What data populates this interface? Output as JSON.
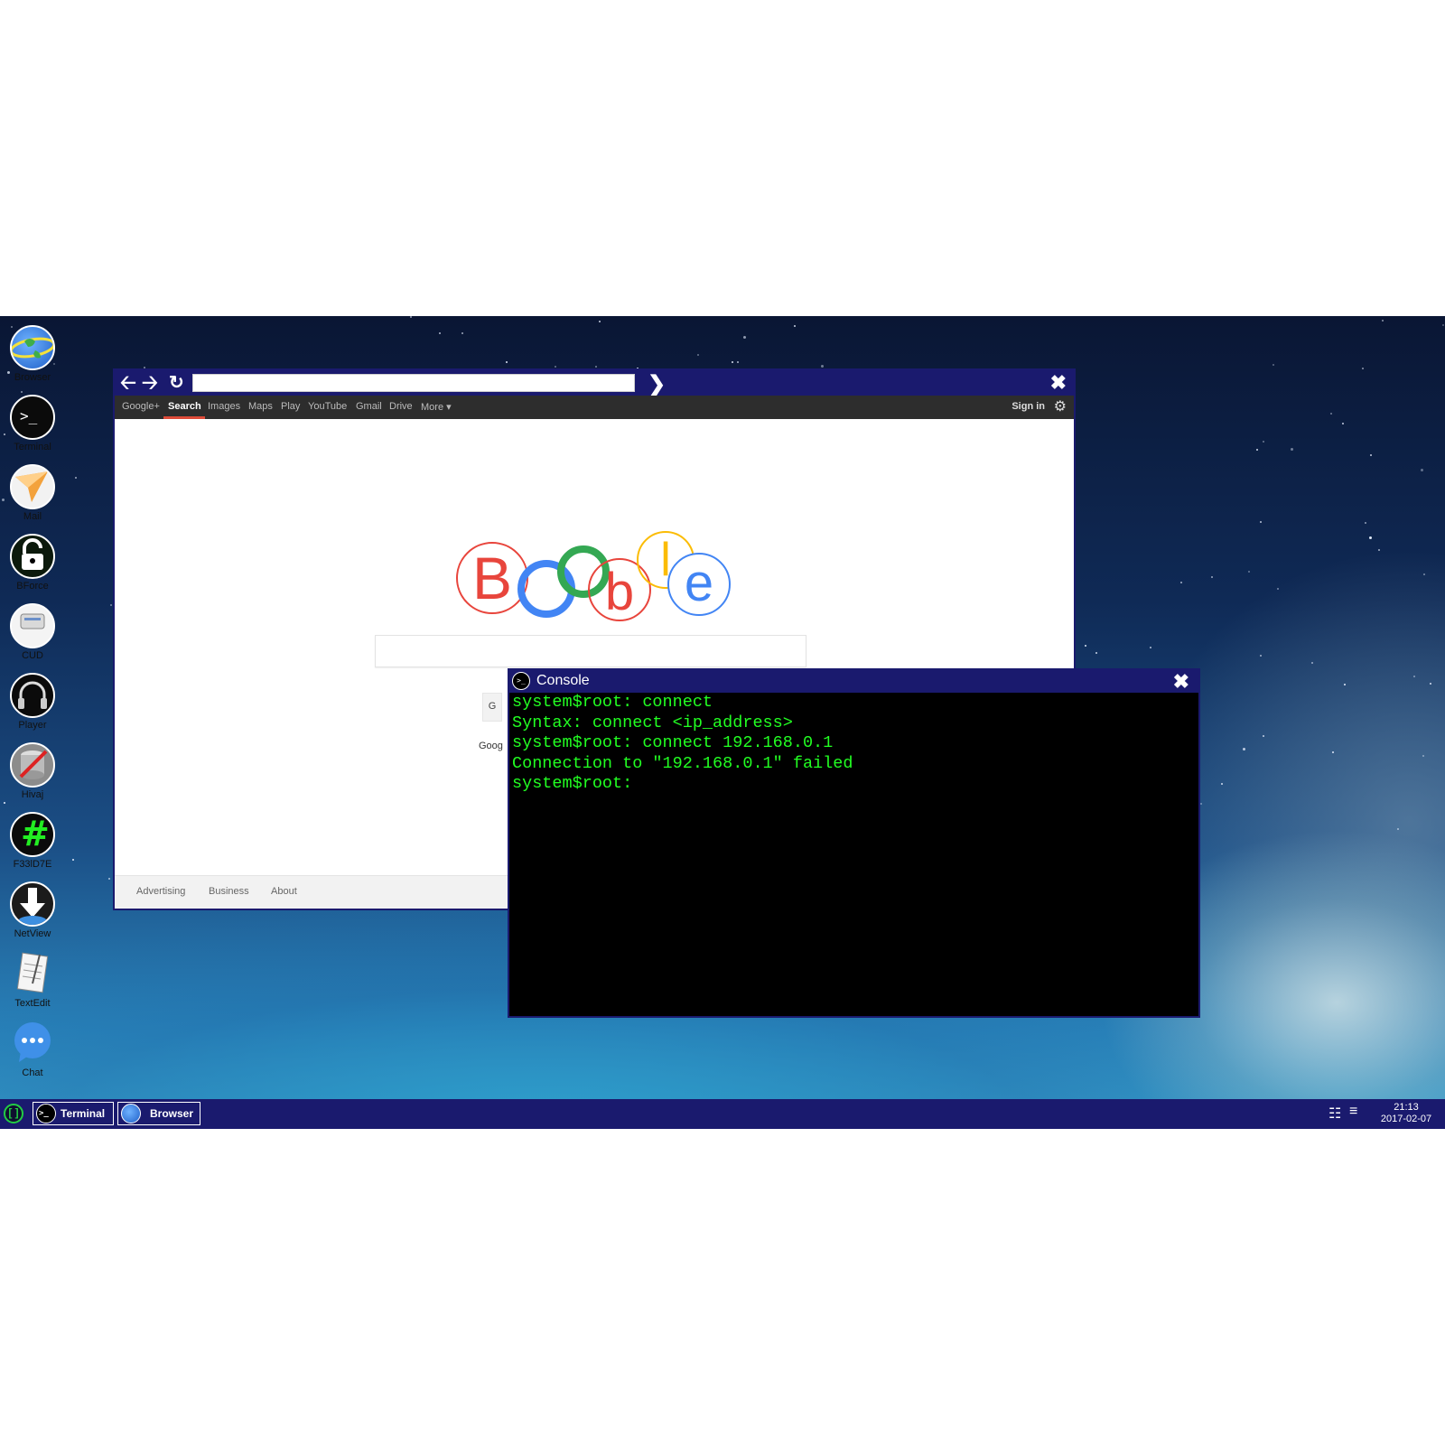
{
  "desktop_icons": [
    {
      "label": "Browser",
      "icon": "globe-icon"
    },
    {
      "label": "Terminal",
      "icon": "terminal-icon"
    },
    {
      "label": "Mail",
      "icon": "paper-plane-icon"
    },
    {
      "label": "BForce",
      "icon": "padlock-icon"
    },
    {
      "label": "CUD",
      "icon": "disk-drive-icon"
    },
    {
      "label": "Player",
      "icon": "headphones-icon"
    },
    {
      "label": "Hivaj",
      "icon": "database-syringe-icon"
    },
    {
      "label": "F33lD7E",
      "icon": "hash-icon"
    },
    {
      "label": "NetView",
      "icon": "download-arrow-icon"
    },
    {
      "label": "TextEdit",
      "icon": "notepad-icon"
    },
    {
      "label": "Chat",
      "icon": "chat-bubble-icon"
    }
  ],
  "browser": {
    "url": "",
    "gbar": {
      "items": [
        "Google+",
        "Search",
        "Images",
        "Maps",
        "Play",
        "YouTube",
        "Gmail",
        "Drive",
        "More ▾"
      ],
      "active": "Search",
      "sign_in": "Sign in"
    },
    "logo_letters": [
      "B",
      "o",
      "o",
      "b",
      "l",
      "e"
    ],
    "logo_colors": [
      "#e8453c",
      "#4285f4",
      "#34a853",
      "#e8453c",
      "#fbbc05",
      "#4285f4"
    ],
    "search_value": "",
    "partial_button_text": "G",
    "partial_text": "Goog",
    "footer": [
      "Advertising",
      "Business",
      "About"
    ]
  },
  "console": {
    "title": "Console",
    "lines": [
      "system$root: connect",
      "Syntax: connect <ip_address>",
      "system$root: connect 192.168.0.1",
      "Connection to \"192.168.0.1\" failed",
      "system$root:"
    ]
  },
  "taskbar": {
    "buttons": [
      {
        "label": "Terminal",
        "icon": "terminal-icon"
      },
      {
        "label": "Browser",
        "icon": "globe-icon"
      }
    ],
    "time": "21:13",
    "date": "2017-02-07"
  },
  "colors": {
    "window_bar": "#1a1a6e",
    "console_text": "#22ff22"
  }
}
